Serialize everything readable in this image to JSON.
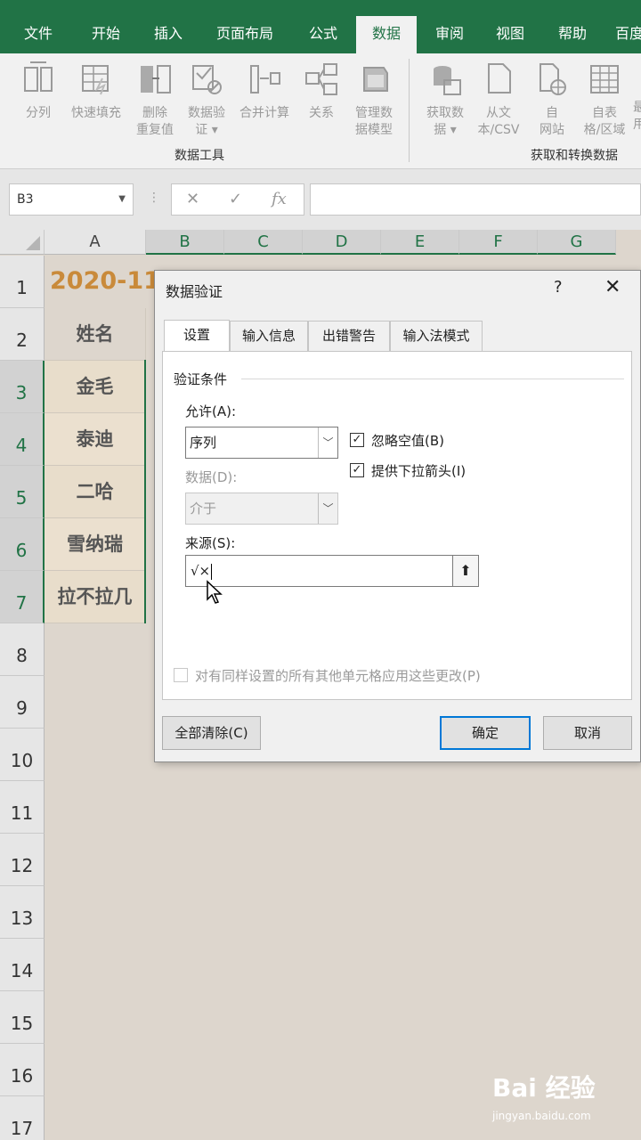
{
  "ribbon_tabs": [
    "文件",
    "开始",
    "插入",
    "页面布局",
    "公式",
    "数据",
    "审阅",
    "视图",
    "帮助",
    "百度"
  ],
  "active_tab": "数据",
  "ribbon": {
    "data_tools": {
      "label": "数据工具",
      "buttons": [
        {
          "label": "分列"
        },
        {
          "label": "快速填充"
        },
        {
          "label": "删除\n重复值"
        },
        {
          "label": "数据验\n证 ▾"
        },
        {
          "label": "合并计算"
        },
        {
          "label": "关系"
        },
        {
          "label": "管理数\n据模型"
        }
      ]
    },
    "get_transform": {
      "label": "获取和转换数据",
      "buttons": [
        {
          "label": "获取数\n据 ▾"
        },
        {
          "label": "从文\n本/CSV"
        },
        {
          "label": "自\n网站"
        },
        {
          "label": "自表\n格/区域"
        },
        {
          "label": "最\n用"
        }
      ]
    }
  },
  "formula_bar": {
    "name_box": "B3",
    "cancel_symbol": "✕",
    "enter_symbol": "✓",
    "fx_symbol": "fx",
    "formula": ""
  },
  "sheet": {
    "columns": [
      "A",
      "B",
      "C",
      "D",
      "E",
      "F",
      "G"
    ],
    "rows": [
      "1",
      "2",
      "3",
      "4",
      "5",
      "6",
      "7",
      "8",
      "9",
      "10",
      "11",
      "12",
      "13",
      "14",
      "15",
      "16",
      "17"
    ],
    "title_text": "2020-11",
    "column_a": [
      "姓名",
      "金毛",
      "泰迪",
      "二哈",
      "雪纳瑞",
      "拉不拉几"
    ]
  },
  "dialog": {
    "title": "数据验证",
    "help": "?",
    "close": "✕",
    "tabs": [
      "设置",
      "输入信息",
      "出错警告",
      "输入法模式"
    ],
    "section_title": "验证条件",
    "allow_label": "允许(A):",
    "allow_value": "序列",
    "data_label": "数据(D):",
    "data_value": "介于",
    "ignore_blank_label": "忽略空值(B)",
    "ignore_blank_checked": true,
    "dropdown_label": "提供下拉箭头(I)",
    "dropdown_checked": true,
    "source_label": "来源(S):",
    "source_value": "√×",
    "apply_all_label": "对有同样设置的所有其他单元格应用这些更改(P)",
    "apply_all_checked": false,
    "clear_button": "全部清除(C)",
    "ok_button": "确定",
    "cancel_button": "取消"
  },
  "watermark": {
    "text": "Bai 经验",
    "url": "jingyan.baidu.com"
  }
}
